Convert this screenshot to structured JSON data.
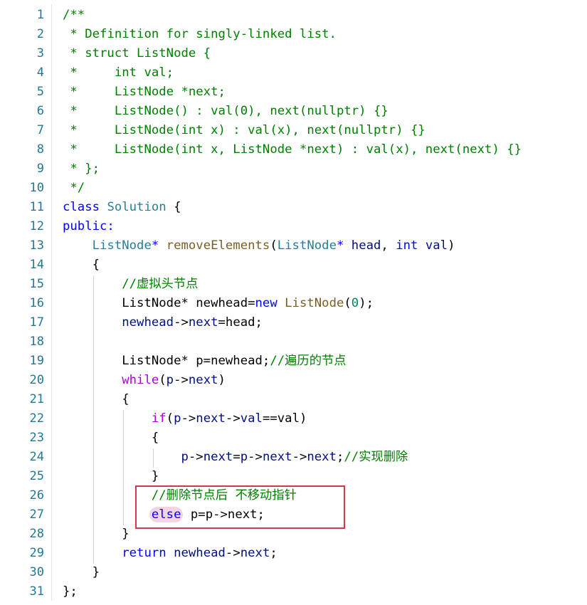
{
  "editor": {
    "lines": [
      {
        "num": "1",
        "tokens": [
          {
            "t": "/**",
            "c": "comment"
          }
        ]
      },
      {
        "num": "2",
        "tokens": [
          {
            "t": " * Definition for singly-linked list.",
            "c": "comment"
          }
        ]
      },
      {
        "num": "3",
        "tokens": [
          {
            "t": " * struct ListNode {",
            "c": "comment"
          }
        ]
      },
      {
        "num": "4",
        "tokens": [
          {
            "t": " *     int val;",
            "c": "comment"
          }
        ]
      },
      {
        "num": "5",
        "tokens": [
          {
            "t": " *     ListNode *next;",
            "c": "comment"
          }
        ]
      },
      {
        "num": "6",
        "tokens": [
          {
            "t": " *     ListNode() : val(0), next(nullptr) {}",
            "c": "comment"
          }
        ]
      },
      {
        "num": "7",
        "tokens": [
          {
            "t": " *     ListNode(int x) : val(x), next(nullptr) {}",
            "c": "comment"
          }
        ]
      },
      {
        "num": "8",
        "tokens": [
          {
            "t": " *     ListNode(int x, ListNode *next) : val(x), next(next) {}",
            "c": "comment"
          }
        ]
      },
      {
        "num": "9",
        "tokens": [
          {
            "t": " * };",
            "c": "comment"
          }
        ]
      },
      {
        "num": "10",
        "tokens": [
          {
            "t": " */",
            "c": "comment"
          }
        ]
      },
      {
        "num": "11",
        "tokens": [
          {
            "t": "class",
            "c": "keyword"
          },
          {
            "t": " ",
            "c": "plain"
          },
          {
            "t": "Solution",
            "c": "type"
          },
          {
            "t": " {",
            "c": "plain"
          }
        ]
      },
      {
        "num": "12",
        "tokens": [
          {
            "t": "public:",
            "c": "keyword"
          }
        ]
      },
      {
        "num": "13",
        "tokens": [
          {
            "t": "    ",
            "c": "plain"
          },
          {
            "t": "ListNode",
            "c": "type"
          },
          {
            "t": "* ",
            "c": "keyword"
          },
          {
            "t": "removeElements",
            "c": "func"
          },
          {
            "t": "(",
            "c": "plain"
          },
          {
            "t": "ListNode",
            "c": "type"
          },
          {
            "t": "* ",
            "c": "keyword"
          },
          {
            "t": "head",
            "c": "var"
          },
          {
            "t": ", ",
            "c": "plain"
          },
          {
            "t": "int",
            "c": "keyword"
          },
          {
            "t": " ",
            "c": "plain"
          },
          {
            "t": "val",
            "c": "var"
          },
          {
            "t": ")",
            "c": "plain"
          }
        ]
      },
      {
        "num": "14",
        "tokens": [
          {
            "t": "    {",
            "c": "plain"
          }
        ]
      },
      {
        "num": "15",
        "tokens": [
          {
            "t": "        ",
            "c": "plain"
          },
          {
            "t": "//虚拟头节点",
            "c": "comment"
          }
        ]
      },
      {
        "num": "16",
        "tokens": [
          {
            "t": "        ListNode* newhead=",
            "c": "plain"
          },
          {
            "t": "new",
            "c": "keyword"
          },
          {
            "t": " ",
            "c": "plain"
          },
          {
            "t": "ListNode",
            "c": "func"
          },
          {
            "t": "(",
            "c": "plain"
          },
          {
            "t": "0",
            "c": "num"
          },
          {
            "t": ");",
            "c": "plain"
          }
        ]
      },
      {
        "num": "17",
        "tokens": [
          {
            "t": "        ",
            "c": "plain"
          },
          {
            "t": "newhead",
            "c": "var"
          },
          {
            "t": "->",
            "c": "plain"
          },
          {
            "t": "next",
            "c": "var"
          },
          {
            "t": "=head;",
            "c": "plain"
          }
        ]
      },
      {
        "num": "18",
        "tokens": [
          {
            "t": "",
            "c": "plain"
          }
        ]
      },
      {
        "num": "19",
        "tokens": [
          {
            "t": "        ListNode* p=newhead;",
            "c": "plain"
          },
          {
            "t": "//遍历的节点",
            "c": "comment"
          }
        ]
      },
      {
        "num": "20",
        "tokens": [
          {
            "t": "        ",
            "c": "plain"
          },
          {
            "t": "while",
            "c": "control"
          },
          {
            "t": "(",
            "c": "plain"
          },
          {
            "t": "p",
            "c": "var"
          },
          {
            "t": "->",
            "c": "plain"
          },
          {
            "t": "next",
            "c": "var"
          },
          {
            "t": ")",
            "c": "plain"
          }
        ]
      },
      {
        "num": "21",
        "tokens": [
          {
            "t": "        {",
            "c": "plain"
          }
        ]
      },
      {
        "num": "22",
        "tokens": [
          {
            "t": "            ",
            "c": "plain"
          },
          {
            "t": "if",
            "c": "control"
          },
          {
            "t": "(",
            "c": "plain"
          },
          {
            "t": "p",
            "c": "var"
          },
          {
            "t": "->",
            "c": "plain"
          },
          {
            "t": "next",
            "c": "var"
          },
          {
            "t": "->",
            "c": "plain"
          },
          {
            "t": "val",
            "c": "var"
          },
          {
            "t": "==val)",
            "c": "plain"
          }
        ]
      },
      {
        "num": "23",
        "tokens": [
          {
            "t": "            {",
            "c": "plain"
          }
        ]
      },
      {
        "num": "24",
        "tokens": [
          {
            "t": "                ",
            "c": "plain"
          },
          {
            "t": "p",
            "c": "var"
          },
          {
            "t": "->",
            "c": "plain"
          },
          {
            "t": "next",
            "c": "var"
          },
          {
            "t": "=",
            "c": "plain"
          },
          {
            "t": "p",
            "c": "var"
          },
          {
            "t": "->",
            "c": "plain"
          },
          {
            "t": "next",
            "c": "var"
          },
          {
            "t": "->",
            "c": "plain"
          },
          {
            "t": "next",
            "c": "var"
          },
          {
            "t": ";",
            "c": "plain"
          },
          {
            "t": "//实现删除",
            "c": "comment"
          }
        ]
      },
      {
        "num": "25",
        "tokens": [
          {
            "t": "            }",
            "c": "plain"
          }
        ]
      },
      {
        "num": "26",
        "tokens": [
          {
            "t": "            ",
            "c": "plain"
          },
          {
            "t": "//删除节点后 不移动指针",
            "c": "comment"
          }
        ]
      },
      {
        "num": "27",
        "tokens": [
          {
            "t": "            ",
            "c": "plain"
          },
          {
            "t": "else",
            "c": "keyword",
            "hl": true
          },
          {
            "t": " p=p->next;",
            "c": "plain"
          }
        ]
      },
      {
        "num": "28",
        "tokens": [
          {
            "t": "        }",
            "c": "plain"
          }
        ]
      },
      {
        "num": "29",
        "tokens": [
          {
            "t": "        ",
            "c": "plain"
          },
          {
            "t": "return",
            "c": "keyword"
          },
          {
            "t": " ",
            "c": "plain"
          },
          {
            "t": "newhead",
            "c": "var"
          },
          {
            "t": "->",
            "c": "plain"
          },
          {
            "t": "next",
            "c": "var"
          },
          {
            "t": ";",
            "c": "plain"
          }
        ]
      },
      {
        "num": "30",
        "tokens": [
          {
            "t": "    }",
            "c": "plain"
          }
        ]
      },
      {
        "num": "31",
        "tokens": [
          {
            "t": "};",
            "c": "plain"
          }
        ]
      }
    ]
  },
  "colors": {
    "comment": "#008000",
    "keyword": "#0000ff",
    "control": "#af00db",
    "type": "#267f99",
    "function": "#795e26",
    "variable": "#001080",
    "number": "#098658",
    "line_number": "#237893",
    "annotation_box": "#d03a4a",
    "highlight": "#f3d4e4"
  }
}
